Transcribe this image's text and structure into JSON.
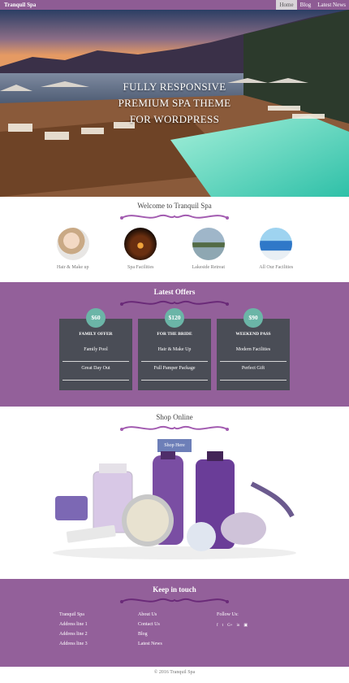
{
  "header": {
    "brand": "Tranquil Spa",
    "nav": [
      "Home",
      "Blog",
      "Latest News"
    ]
  },
  "hero": {
    "line1": "FULLY RESPONSIVE",
    "line2": "PREMIUM SPA THEME",
    "line3": "FOR WORDPRESS"
  },
  "welcome": {
    "title": "Welcome to Tranquil Spa",
    "features": [
      "Hair & Make up",
      "Spa Facilities",
      "Lakeside Retreat",
      "All Our Facilities"
    ]
  },
  "offers": {
    "title": "Latest Offers",
    "cards": [
      {
        "price": "$60",
        "title": "FAMILY OFFER",
        "items": [
          "Family Pool",
          "Great Day Out"
        ]
      },
      {
        "price": "$120",
        "title": "FOR THE BRIDE",
        "items": [
          "Hair & Make Up",
          "Full Pamper Package"
        ]
      },
      {
        "price": "$90",
        "title": "WEEKEND PASS",
        "items": [
          "Modern Facilities",
          "Perfect Gift"
        ]
      }
    ]
  },
  "shop": {
    "title": "Shop Online",
    "button": "Shop Here"
  },
  "footer": {
    "title": "Keep in touch",
    "address": [
      "Tranquil Spa",
      "Address line 1",
      "Address line 2",
      "Address line 3"
    ],
    "links": [
      "About Us",
      "Contact Us",
      "Blog",
      "Latest News"
    ],
    "follow": "Follow Us:",
    "social": [
      "f",
      "t",
      "G+",
      "in",
      "▣"
    ],
    "copyright": "© 2016 Tranquil Spa"
  },
  "colors": {
    "purple": "#93609a",
    "teal": "#6bb5a7",
    "card": "#4a4d56",
    "button": "#6d7fb8"
  }
}
